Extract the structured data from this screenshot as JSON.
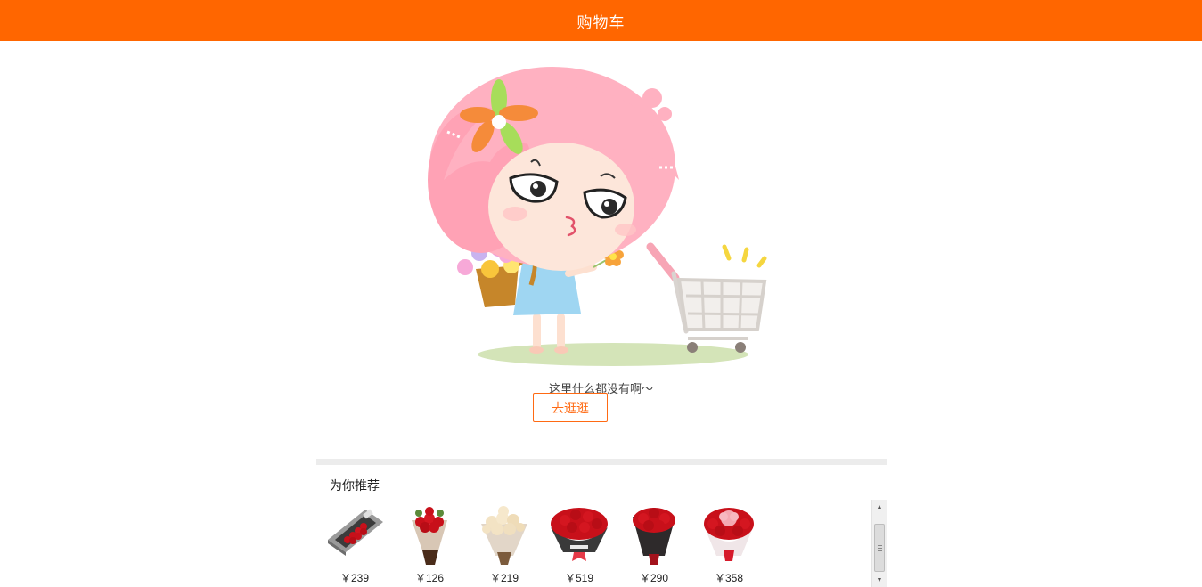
{
  "header": {
    "title": "购物车",
    "bg_color": "#ff6600"
  },
  "empty_state": {
    "message": "这里什么都没有啊～",
    "button_label": "去逛逛",
    "accent_color": "#ff6a13"
  },
  "recommend": {
    "title": "为你推荐",
    "items": [
      {
        "price": "￥239"
      },
      {
        "price": "￥126"
      },
      {
        "price": "￥219"
      },
      {
        "price": "￥519"
      },
      {
        "price": "￥290"
      },
      {
        "price": "￥358"
      }
    ]
  }
}
